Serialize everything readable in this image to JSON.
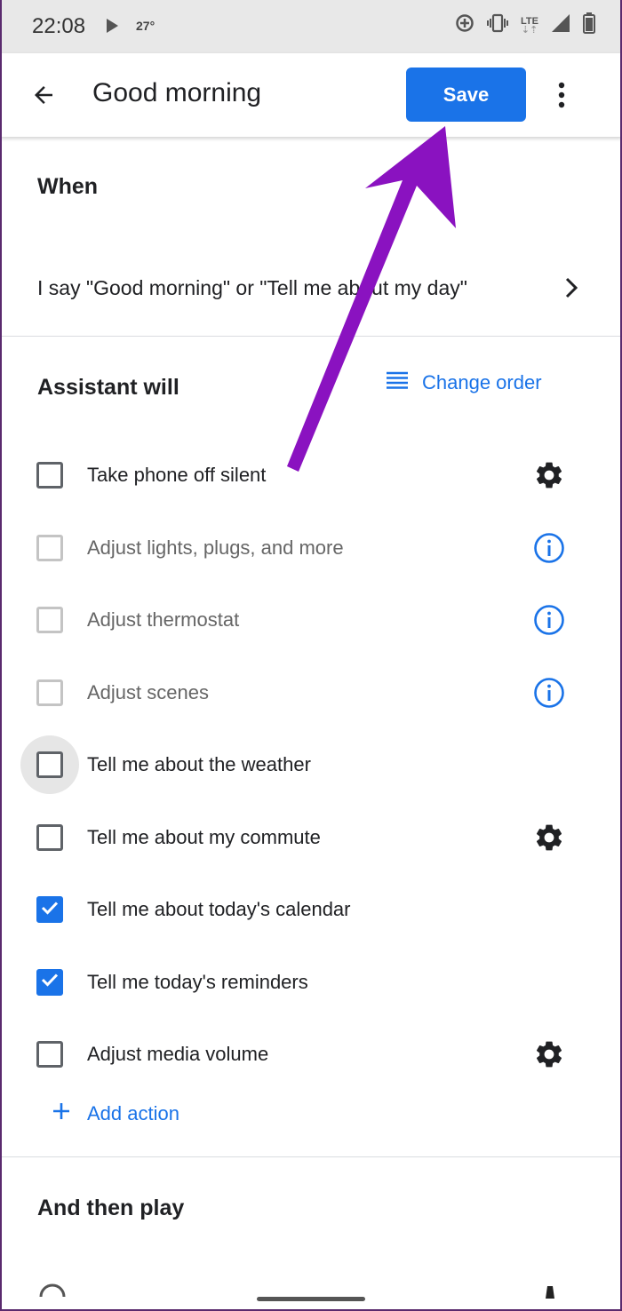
{
  "status_bar": {
    "time": "22:08",
    "temperature": "27°",
    "network": "LTE",
    "icons": [
      "play-icon",
      "data-saver-icon",
      "vibrate-icon",
      "lte-icon",
      "signal-icon",
      "battery-icon"
    ]
  },
  "app_bar": {
    "title": "Good morning",
    "save_label": "Save",
    "icons": [
      "back-arrow-icon",
      "more-vert-icon"
    ]
  },
  "when": {
    "heading": "When",
    "trigger": "I say \"Good morning\" or \"Tell me about my day\""
  },
  "assistant_will": {
    "heading": "Assistant will",
    "change_order_label": "Change order",
    "actions": [
      {
        "label": "Take phone off silent",
        "checked": false,
        "disabled": false,
        "icon": "gear-icon"
      },
      {
        "label": "Adjust lights, plugs, and more",
        "checked": false,
        "disabled": true,
        "icon": "info-icon"
      },
      {
        "label": "Adjust thermostat",
        "checked": false,
        "disabled": true,
        "icon": "info-icon"
      },
      {
        "label": "Adjust scenes",
        "checked": false,
        "disabled": true,
        "icon": "info-icon"
      },
      {
        "label": "Tell me about the weather",
        "checked": false,
        "disabled": false,
        "icon": ""
      },
      {
        "label": "Tell me about my commute",
        "checked": false,
        "disabled": false,
        "icon": "gear-icon"
      },
      {
        "label": "Tell me about today's calendar",
        "checked": true,
        "disabled": false,
        "icon": ""
      },
      {
        "label": "Tell me today's reminders",
        "checked": true,
        "disabled": false,
        "icon": ""
      },
      {
        "label": "Adjust media volume",
        "checked": false,
        "disabled": false,
        "icon": "gear-icon"
      }
    ],
    "add_action_label": "Add action"
  },
  "and_then_play": {
    "heading": "And then play"
  },
  "colors": {
    "accent": "#1a73e8",
    "annotation_arrow": "#8a12c0",
    "status_bar": "#e8e8e8"
  }
}
